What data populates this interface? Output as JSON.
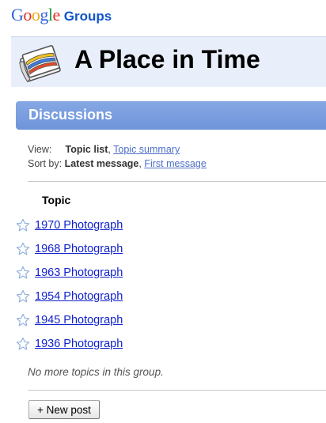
{
  "header": {
    "logo_google": "Google",
    "logo_groups": "Groups"
  },
  "group": {
    "title": "A Place in Time",
    "icon": "newspaper-icon"
  },
  "discussions": {
    "title": "Discussions",
    "view_label": "View:",
    "view_current": "Topic list",
    "view_alt": "Topic summary",
    "sort_label": "Sort by:",
    "sort_current": "Latest message",
    "sort_alt": "First message",
    "topic_column": "Topic",
    "topics": [
      {
        "title": "1970 Photograph",
        "icon": "star-icon"
      },
      {
        "title": "1968 Photograph",
        "icon": "star-icon"
      },
      {
        "title": "1963 Photograph",
        "icon": "star-icon"
      },
      {
        "title": "1954 Photograph",
        "icon": "star-icon"
      },
      {
        "title": "1945 Photograph",
        "icon": "star-icon"
      },
      {
        "title": "1936 Photograph",
        "icon": "star-icon"
      }
    ],
    "no_more_text": "No more topics in this group.",
    "new_post_label": "+ New post"
  },
  "colors": {
    "google_blue": "#3366dd",
    "google_red": "#dd3322",
    "google_yellow": "#eeaa11",
    "google_green": "#229944",
    "groups_blue": "#1155cc",
    "title_bar_bg": "#e8eefa",
    "discussions_bar": "#7ea2e0",
    "link": "#1122cc"
  }
}
